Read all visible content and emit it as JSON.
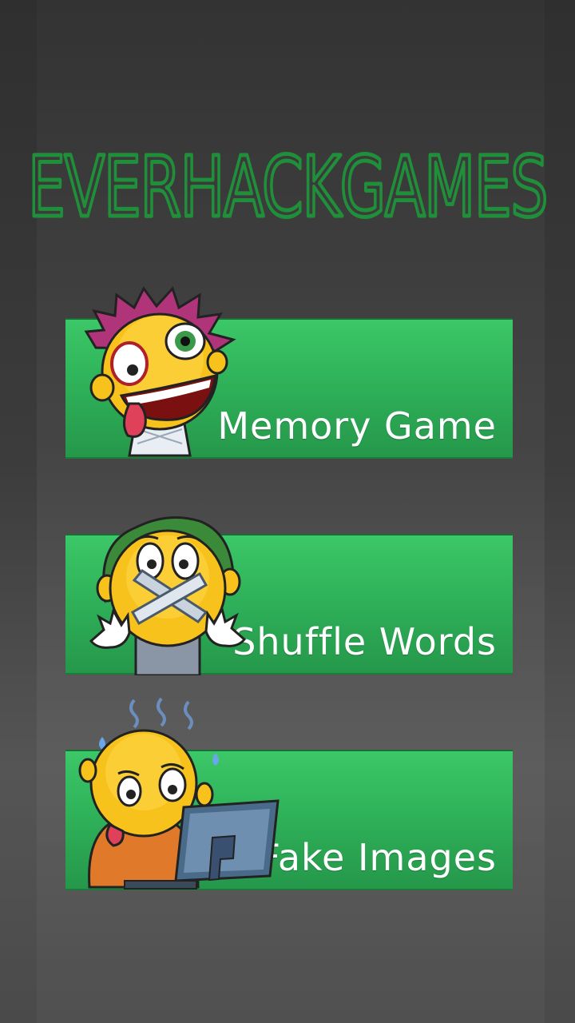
{
  "app": {
    "logo_text": "EVERHACKGAMES",
    "accent_color": "#1f8f3a"
  },
  "menu": {
    "items": [
      {
        "label": "Memory Game",
        "icon": "crazy-face-icon"
      },
      {
        "label": "Shuffle Words",
        "icon": "taped-mouth-face-icon"
      },
      {
        "label": "Fake Images",
        "icon": "worried-computer-face-icon"
      }
    ],
    "button_color": "#2fb25a"
  }
}
